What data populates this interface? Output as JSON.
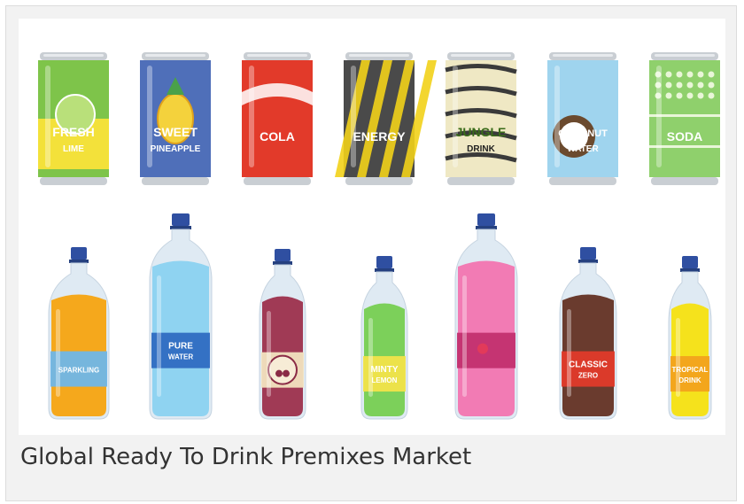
{
  "caption": "Global Ready To Drink Premixes Market",
  "cans": [
    {
      "line1": "FRESH",
      "line2": "LIME",
      "body_color": "#7ec44a",
      "accent_color": "#f3e13a"
    },
    {
      "line1": "SWEET",
      "line2": "PINEAPPLE",
      "body_color": "#4f6fb9",
      "accent_color": "#f4d23c"
    },
    {
      "line1": "COLA",
      "line2": "",
      "body_color": "#e23a2a",
      "accent_color": "#ffffff"
    },
    {
      "line1": "ENERGY",
      "line2": "",
      "body_color": "#4a4a4a",
      "accent_color": "#f2d21a"
    },
    {
      "line1": "JUNGLE",
      "line2": "DRINK",
      "body_color": "#efe8c4",
      "accent_color": "#3a3a3a"
    },
    {
      "line1": "COCONUT",
      "line2": "WATER",
      "body_color": "#9fd4ee",
      "accent_color": "#6b4a2e"
    },
    {
      "line1": "SODA",
      "line2": "",
      "body_color": "#8fd06c",
      "accent_color": "#e9f6d8"
    }
  ],
  "bottles": [
    {
      "label1": "SPARKLING",
      "label2": "",
      "liquid_color": "#f5a81c",
      "label_color": "#6fb6e8"
    },
    {
      "label1": "PURE",
      "label2": "WATER",
      "liquid_color": "#8fd3f1",
      "label_color": "#2f6cc1"
    },
    {
      "label1": "",
      "label2": "",
      "liquid_color": "#a03a55",
      "label_color": "#f2e3c0"
    },
    {
      "label1": "MINTY",
      "label2": "LEMON",
      "liquid_color": "#7cd05a",
      "label_color": "#f2e34a"
    },
    {
      "label1": "",
      "label2": "",
      "liquid_color": "#f27bb4",
      "label_color": "#c2306f"
    },
    {
      "label1": "CLASSIC",
      "label2": "ZERO",
      "liquid_color": "#6a3b2e",
      "label_color": "#e23a2a"
    },
    {
      "label1": "TROPICAL",
      "label2": "DRINK",
      "liquid_color": "#f5e21c",
      "label_color": "#f2a21c"
    }
  ]
}
